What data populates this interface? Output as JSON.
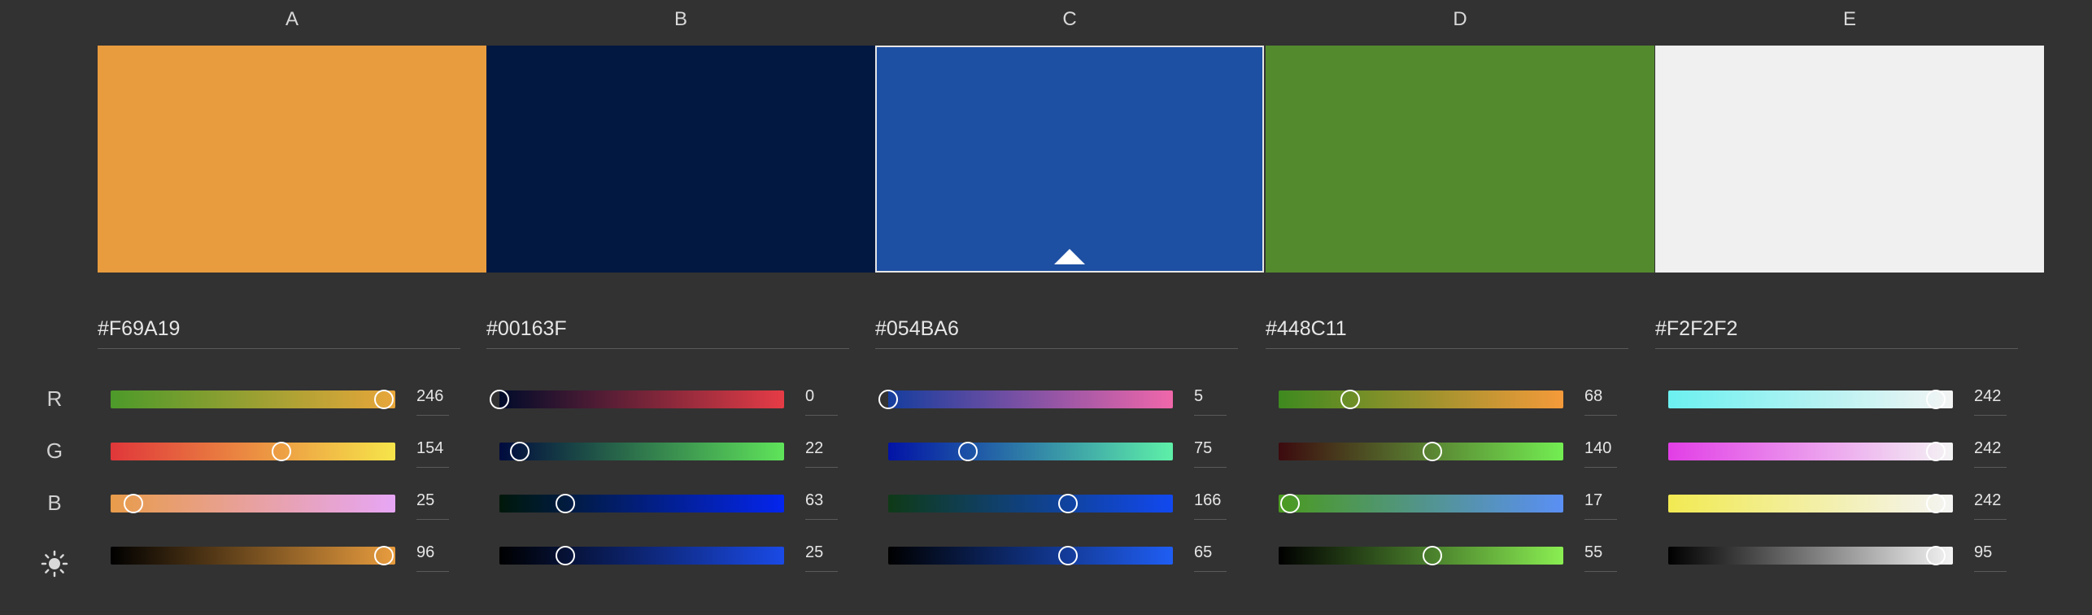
{
  "columns": [
    {
      "letter": "A",
      "hex": "#F69A19",
      "swatch": "#E89C3E",
      "values": [
        246,
        154,
        25,
        96
      ],
      "gradients": [
        [
          "#4c9a2a",
          "#e8a63a"
        ],
        [
          "#e0373a",
          "#f6e54a"
        ],
        [
          "#e89c4a",
          "#e7a6f5"
        ],
        [
          "#000000",
          "#e89c3e"
        ]
      ],
      "positions": [
        0.96,
        0.6,
        0.08,
        0.96
      ]
    },
    {
      "letter": "B",
      "hex": "#00163F",
      "swatch": "#021840",
      "values": [
        0,
        22,
        63,
        25
      ],
      "gradients": [
        [
          "#000b2a",
          "#e63c46"
        ],
        [
          "#000b3e",
          "#5fe45a"
        ],
        [
          "#00180a",
          "#0425ee"
        ],
        [
          "#000000",
          "#1a4ae6"
        ]
      ],
      "positions": [
        0.0,
        0.07,
        0.23,
        0.23
      ]
    },
    {
      "letter": "C",
      "hex": "#054BA6",
      "swatch": "#1D4FA2",
      "values": [
        5,
        75,
        166,
        65
      ],
      "gradients": [
        [
          "#153d9e",
          "#f067aa"
        ],
        [
          "#0213a6",
          "#5ef0a8"
        ],
        [
          "#0f3a17",
          "#1148f0"
        ],
        [
          "#000000",
          "#1f5ef4"
        ]
      ],
      "positions": [
        0.0,
        0.28,
        0.63,
        0.63
      ]
    },
    {
      "letter": "D",
      "hex": "#448C11",
      "swatch": "#548A2E",
      "values": [
        68,
        140,
        17,
        55
      ],
      "gradients": [
        [
          "#3e8a1f",
          "#f59a3a"
        ],
        [
          "#3c0a0e",
          "#73ee52"
        ],
        [
          "#4a9a1f",
          "#5a8ff5"
        ],
        [
          "#000000",
          "#8aee52"
        ]
      ],
      "positions": [
        0.25,
        0.54,
        0.04,
        0.54
      ]
    },
    {
      "letter": "E",
      "hex": "#F2F2F2",
      "swatch": "#F0F0F0",
      "values": [
        242,
        242,
        242,
        95
      ],
      "gradients": [
        [
          "#6cf0f0",
          "#f4f4f4"
        ],
        [
          "#e23ee6",
          "#f4f4f4"
        ],
        [
          "#f2ea52",
          "#f4f4f4"
        ],
        [
          "#000000",
          "#f4f4f4"
        ]
      ],
      "positions": [
        0.94,
        0.94,
        0.94,
        0.94
      ]
    }
  ],
  "row_labels": [
    "R",
    "G",
    "B"
  ],
  "brightness_icon": "sun-icon",
  "selected_index": 2
}
